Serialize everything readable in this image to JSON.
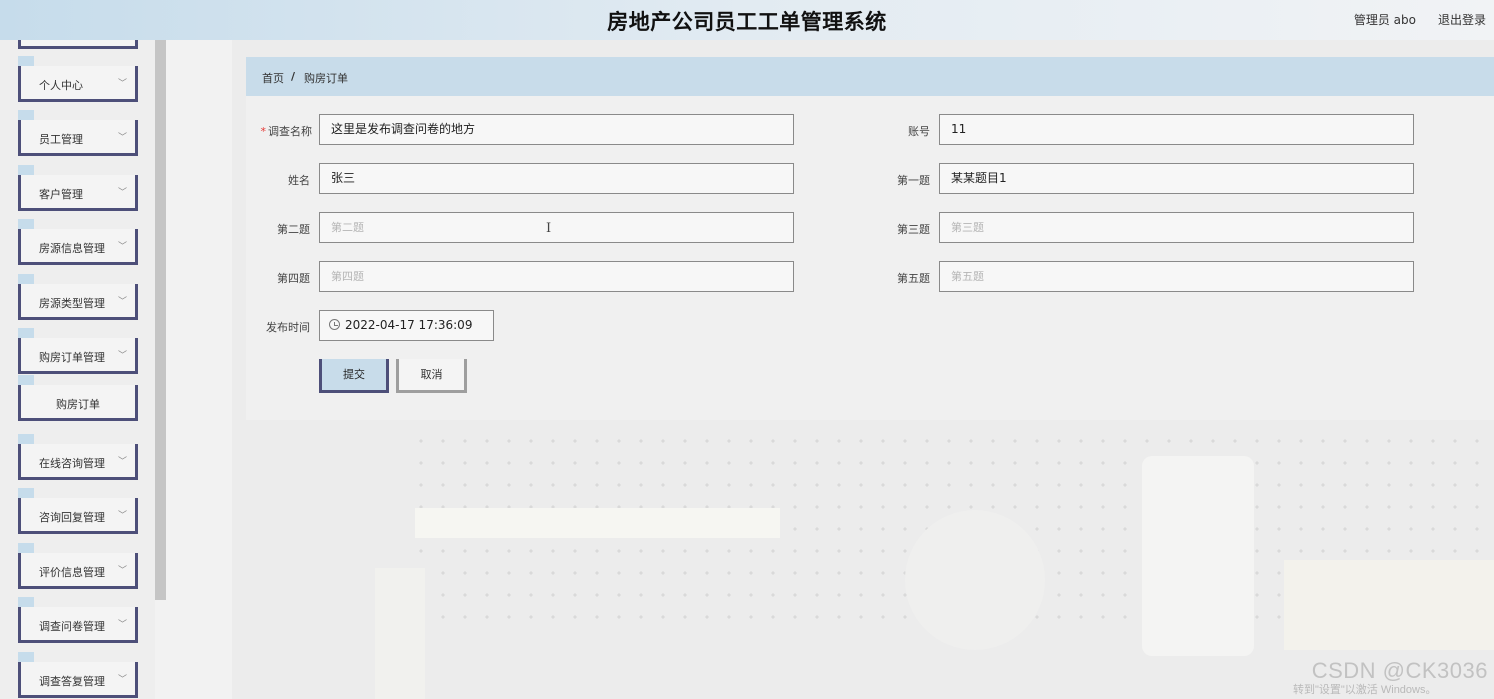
{
  "header": {
    "title": "房地产公司员工工单管理系统",
    "user": "管理员 abo",
    "logout": "退出登录"
  },
  "sidebar": {
    "items": [
      {
        "label": "个人中心"
      },
      {
        "label": "员工管理"
      },
      {
        "label": "客户管理"
      },
      {
        "label": "房源信息管理"
      },
      {
        "label": "房源类型管理"
      },
      {
        "label": "购房订单管理"
      },
      {
        "label": "购房订单"
      },
      {
        "label": "在线咨询管理"
      },
      {
        "label": "咨询回复管理"
      },
      {
        "label": "评价信息管理"
      },
      {
        "label": "调查问卷管理"
      },
      {
        "label": "调查答复管理"
      }
    ]
  },
  "breadcrumb": {
    "home": "首页",
    "separator": "/",
    "current": "购房订单"
  },
  "form": {
    "survey_name": {
      "label": "调查名称",
      "required_mark": "*",
      "value": "这里是发布调查问卷的地方"
    },
    "account": {
      "label": "账号",
      "value": "11"
    },
    "name": {
      "label": "姓名",
      "value": "张三"
    },
    "q1": {
      "label": "第一题",
      "value": "某某题目1"
    },
    "q2": {
      "label": "第二题",
      "placeholder": "第二题"
    },
    "q3": {
      "label": "第三题",
      "placeholder": "第三题"
    },
    "q4": {
      "label": "第四题",
      "placeholder": "第四题"
    },
    "q5": {
      "label": "第五题",
      "placeholder": "第五题"
    },
    "publish_time": {
      "label": "发布时间",
      "value": "2022-04-17 17:36:09"
    },
    "submit_label": "提交",
    "cancel_label": "取消"
  },
  "overlay": {
    "watermark": "CSDN @CK3036",
    "activation": "转到\"设置\"以激活 Windows。"
  },
  "colors": {
    "accent": "#4d4f79",
    "header_bg": "#c6dceb",
    "breadcrumb_bg": "#c8dcea",
    "required": "#e53935"
  }
}
